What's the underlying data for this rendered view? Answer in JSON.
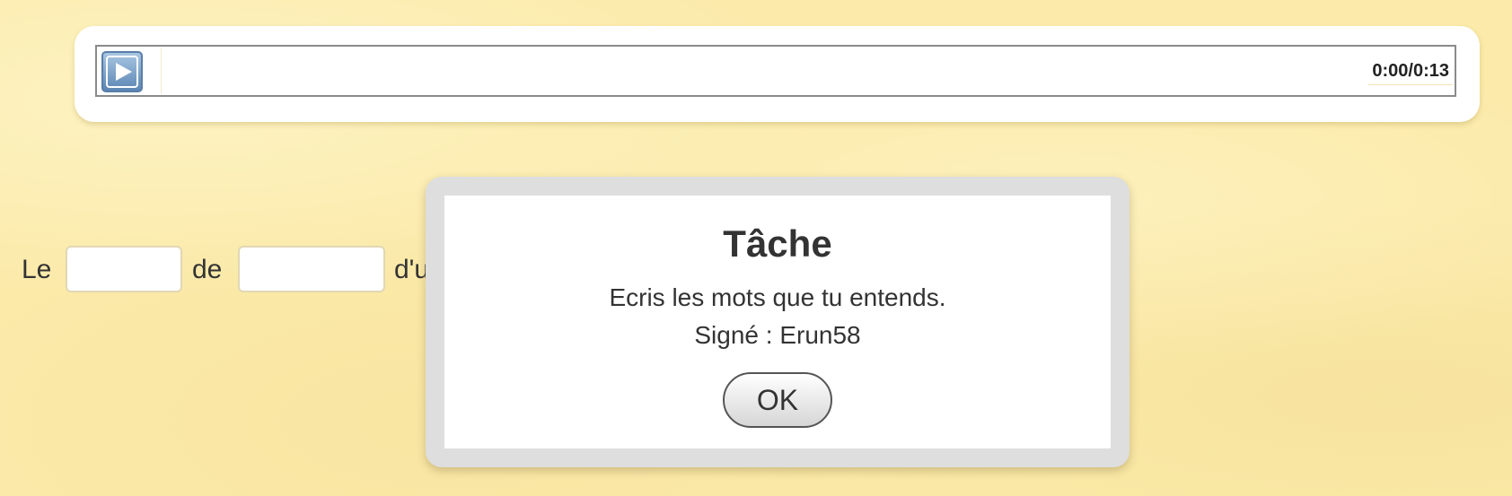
{
  "player": {
    "play_icon": "play-icon",
    "time": "0:00/0:13",
    "colors": {
      "button": "#5b86b4",
      "border": "#8a8a8a"
    }
  },
  "exercise": {
    "words": [
      "Le",
      "de",
      "d'u"
    ],
    "blanks": [
      {
        "value": "",
        "placeholder": ""
      },
      {
        "value": "",
        "placeholder": ""
      }
    ]
  },
  "dialog": {
    "title": "Tâche",
    "message": "Ecris les mots que tu entends.",
    "signature": "Signé : Erun58",
    "ok_label": "OK"
  },
  "colors": {
    "background": "#fbeaa9",
    "dialog_frame": "#dedede",
    "text": "#333333"
  }
}
